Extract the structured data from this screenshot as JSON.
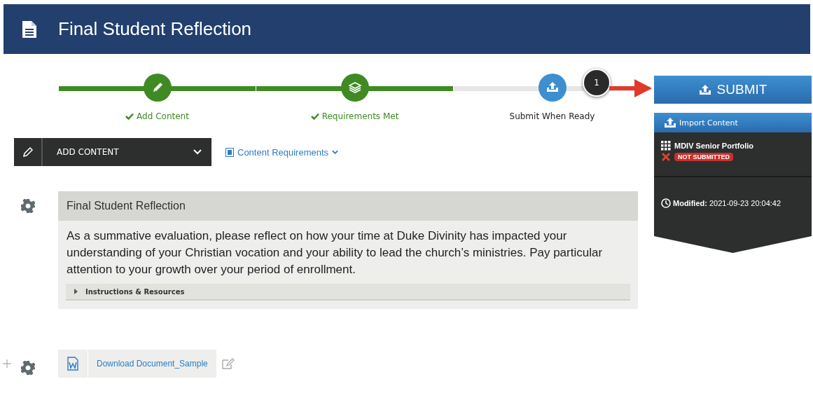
{
  "header": {
    "title": "Final Student Reflection"
  },
  "steps": [
    {
      "label": "Add Content",
      "complete": true
    },
    {
      "label": "Requirements Met",
      "complete": true
    },
    {
      "label": "Submit When Ready",
      "complete": false
    }
  ],
  "callout": {
    "number": "1"
  },
  "submit_button": {
    "label": "SUBMIT"
  },
  "import_panel": {
    "title": "Import Content",
    "portfolio": "MDIV Senior Portfolio",
    "status": "NOT SUBMITTED",
    "modified_label": "Modified:",
    "modified_value": "2021-09-23 20:04:42"
  },
  "toolbar": {
    "add_content": "ADD CONTENT",
    "requirements_link": "Content Requirements"
  },
  "card": {
    "title": "Final Student Reflection",
    "body": "As a summative evaluation, please reflect on how your time at Duke Divinity has impacted your understanding of your Christian vocation and your ability to lead the church’s ministries. Pay particular attention to your growth over your period of enrollment.",
    "instructions": {
      "label": "Instructions & Resources",
      "expanded": false
    }
  },
  "download": {
    "label": "Download Document_Sample"
  }
}
